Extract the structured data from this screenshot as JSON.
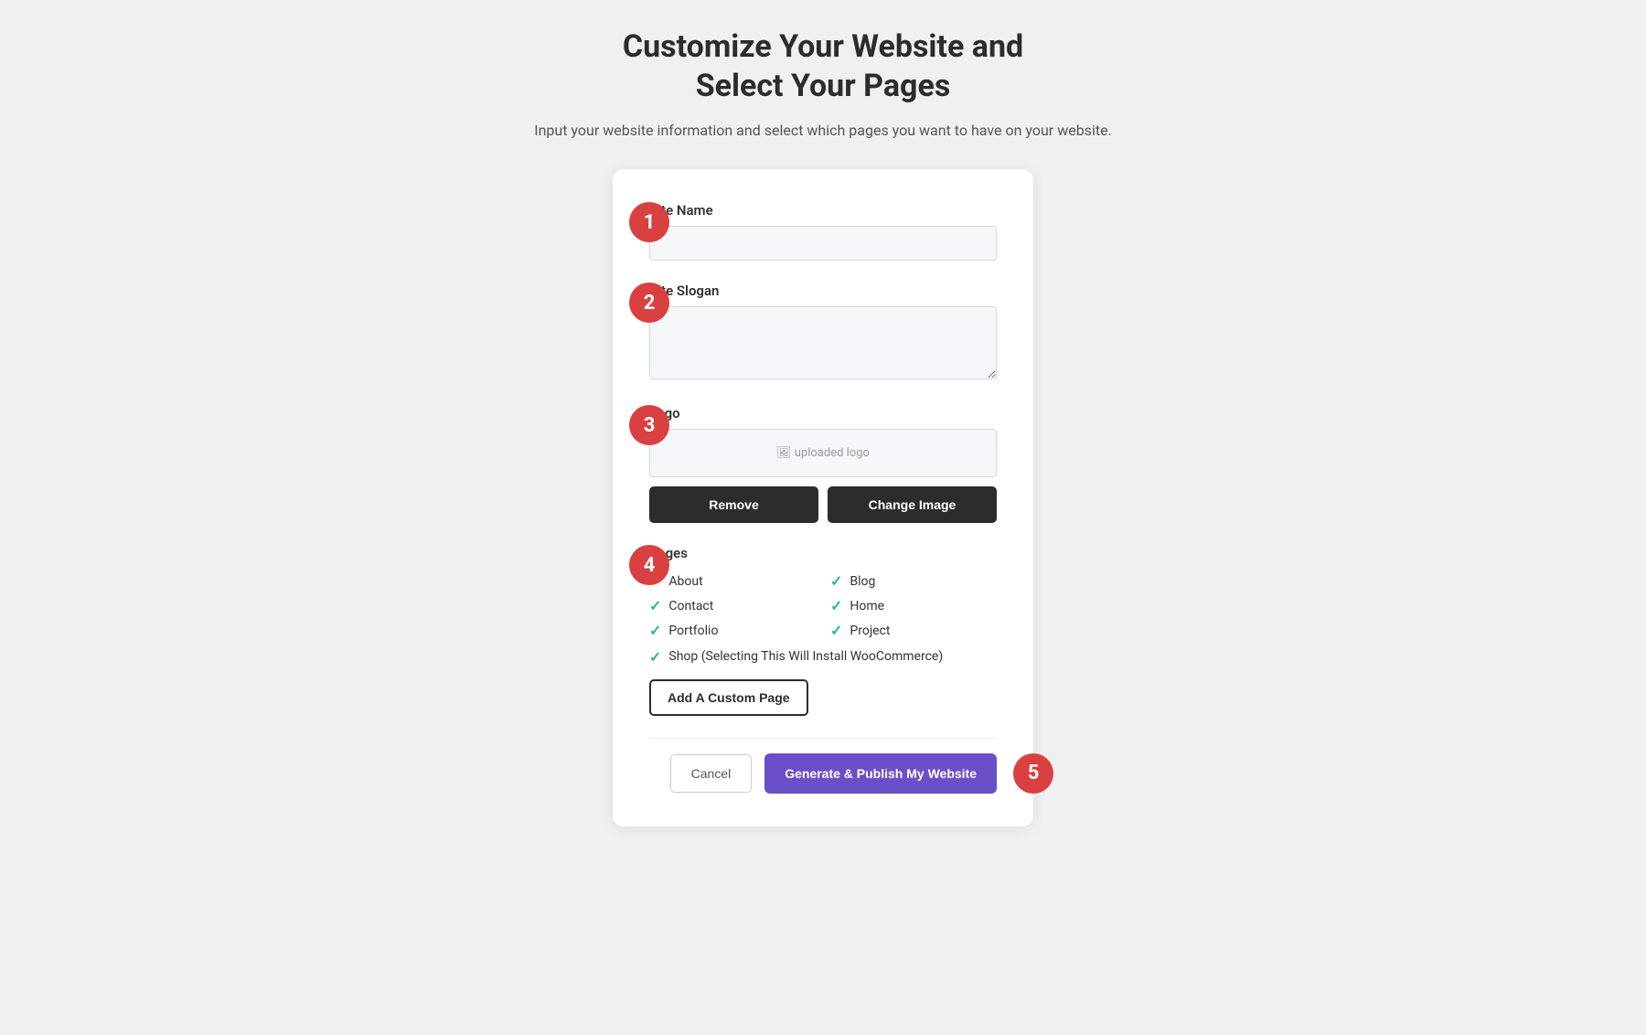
{
  "header": {
    "title_line1": "Customize Your Website and",
    "title_line2": "Select Your Pages",
    "subtitle": "Input your website information and select which pages you want to have on your website."
  },
  "steps": {
    "step1": "1",
    "step2": "2",
    "step3": "3",
    "step4": "4",
    "step5": "5"
  },
  "form": {
    "site_name_label": "Site Name",
    "site_name_placeholder": "",
    "site_slogan_label": "Site Slogan",
    "site_slogan_placeholder": "",
    "logo_label": "Logo",
    "logo_placeholder": "uploaded logo",
    "remove_btn": "Remove",
    "change_image_btn": "Change Image",
    "pages_label": "Pages",
    "pages": [
      {
        "name": "About",
        "checked": true
      },
      {
        "name": "Blog",
        "checked": true
      },
      {
        "name": "Contact",
        "checked": true
      },
      {
        "name": "Home",
        "checked": true
      },
      {
        "name": "Portfolio",
        "checked": true
      },
      {
        "name": "Project",
        "checked": true
      }
    ],
    "shop_page_label": "Shop (Selecting This Will Install WooCommerce)",
    "shop_checked": true,
    "add_custom_page_btn": "Add A Custom Page",
    "cancel_btn": "Cancel",
    "publish_btn": "Generate & Publish My Website"
  }
}
